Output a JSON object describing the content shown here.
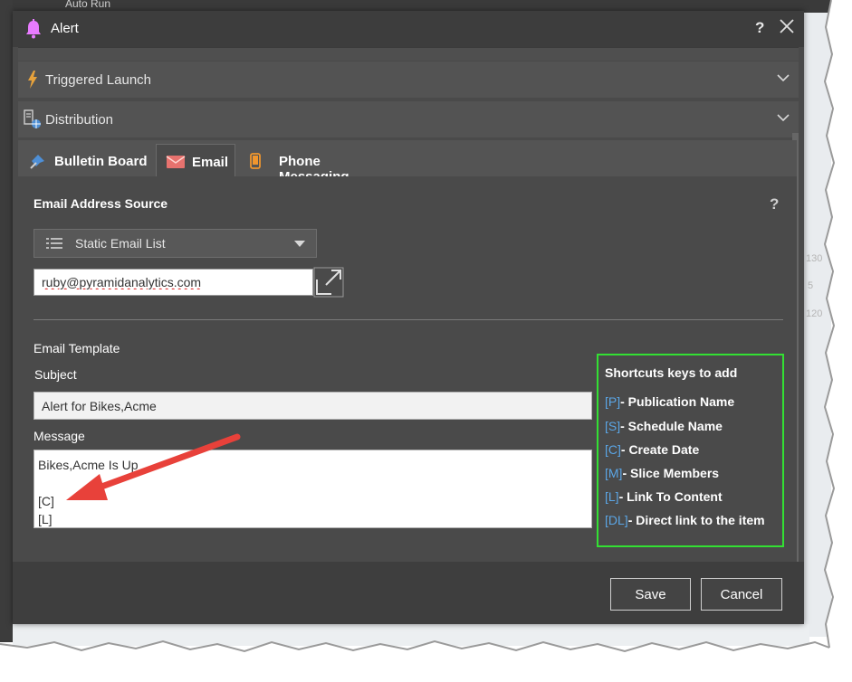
{
  "background": {
    "run_label": "Auto Run",
    "right_numbers": [
      "130",
      "5",
      "120"
    ]
  },
  "dialog": {
    "title": "Alert",
    "help_label": "?",
    "accent_color": "#e87bff"
  },
  "sections": {
    "triggered_launch": "Triggered Launch",
    "distribution": "Distribution"
  },
  "tabs": [
    {
      "label": "Bulletin Board",
      "active": false
    },
    {
      "label": "Email",
      "active": true
    },
    {
      "label": "Phone Messaging",
      "active": false
    }
  ],
  "email": {
    "source_heading": "Email Address Source",
    "help_label": "?",
    "source_selected": "Static Email List",
    "address_value": "ruby@pyramidanalytics.com",
    "template_heading": "Email Template",
    "subject_label": "Subject",
    "subject_value": "Alert for Bikes,Acme",
    "message_label": "Message",
    "message_lines": [
      "Bikes,Acme Is Up",
      "",
      "[C]",
      "[L]"
    ]
  },
  "shortcuts": {
    "title": "Shortcuts keys to add",
    "items": [
      {
        "key": "[P]",
        "desc": "- Publication Name"
      },
      {
        "key": "[S]",
        "desc": "- Schedule Name"
      },
      {
        "key": "[C]",
        "desc": "- Create Date"
      },
      {
        "key": "[M]",
        "desc": "- Slice Members"
      },
      {
        "key": "[L]",
        "desc": "- Link To Content"
      },
      {
        "key": "[DL]",
        "desc": "- Direct link to the item"
      }
    ],
    "border_color": "#33e033",
    "key_color": "#5ba6e6"
  },
  "footer": {
    "save_label": "Save",
    "cancel_label": "Cancel"
  },
  "annotation": {
    "arrow_color": "#e8413a"
  }
}
